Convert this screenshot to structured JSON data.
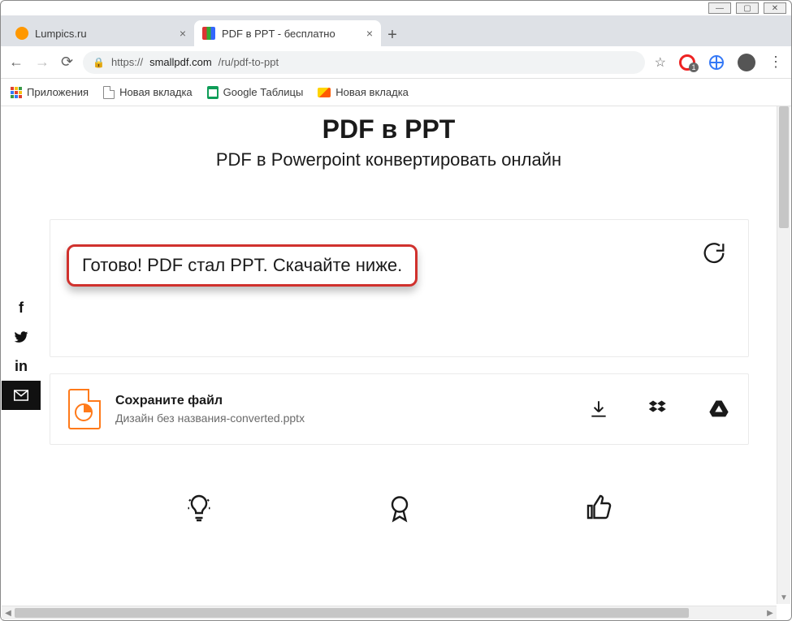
{
  "window_controls": {
    "min": "—",
    "max": "▢",
    "close": "✕"
  },
  "tabs": [
    {
      "title": "Lumpics.ru",
      "active": false
    },
    {
      "title": "PDF в PPT - бесплатно",
      "active": true
    }
  ],
  "addressbar": {
    "scheme": "https://",
    "host": "smallpdf.com",
    "path": "/ru/pdf-to-ppt"
  },
  "bookmarks": [
    {
      "label": "Приложения"
    },
    {
      "label": "Новая вкладка"
    },
    {
      "label": "Google Таблицы"
    },
    {
      "label": "Новая вкладка"
    }
  ],
  "page": {
    "title": "PDF в PPT",
    "subtitle": "PDF в Powerpoint конвертировать онлайн",
    "status_message": "Готово! PDF стал PPT. Скачайте ниже.",
    "file_section_title": "Сохраните файл",
    "file_name": "Дизайн без названия-converted.pptx"
  }
}
